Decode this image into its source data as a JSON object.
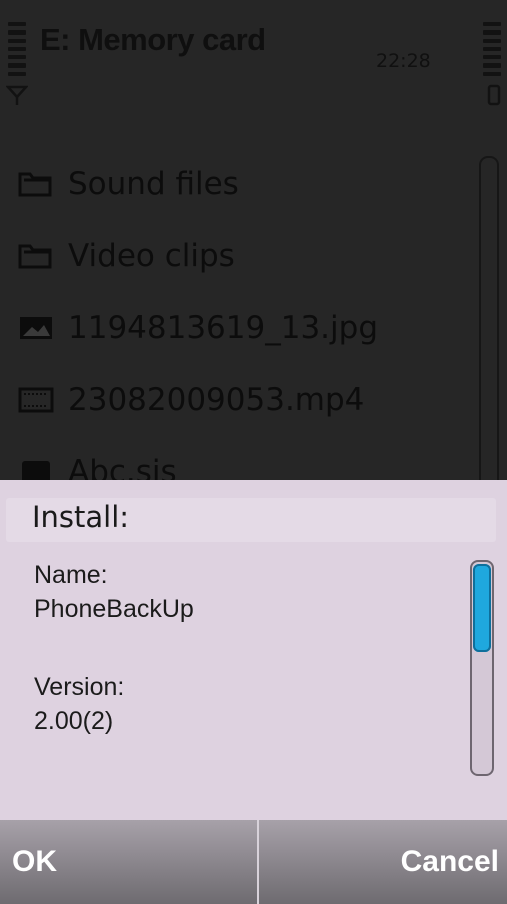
{
  "status_bar": {
    "title": "E: Memory card",
    "time": "22:28",
    "signal_icon": "signal-bars-icon",
    "antenna_icon": "antenna-icon",
    "battery_icon": "battery-icon"
  },
  "file_list": {
    "items": [
      {
        "label": "Sound files",
        "icon": "folder-icon"
      },
      {
        "label": "Video clips",
        "icon": "folder-icon"
      },
      {
        "label": "1194813619_13.jpg",
        "icon": "image-icon"
      },
      {
        "label": "23082009053.mp4",
        "icon": "video-icon"
      },
      {
        "label": "Abc.sis",
        "icon": "package-icon"
      }
    ]
  },
  "dialog": {
    "title": "Install:",
    "name_label": "Name:",
    "name_value": "PhoneBackUp",
    "version_label": "Version:",
    "version_value": "2.00(2)"
  },
  "softkeys": {
    "left": "OK",
    "right": "Cancel"
  },
  "colors": {
    "dialog_bg": "#ded2e0",
    "scroll_thumb": "#1fa8de",
    "dim_bg": "#262626"
  }
}
